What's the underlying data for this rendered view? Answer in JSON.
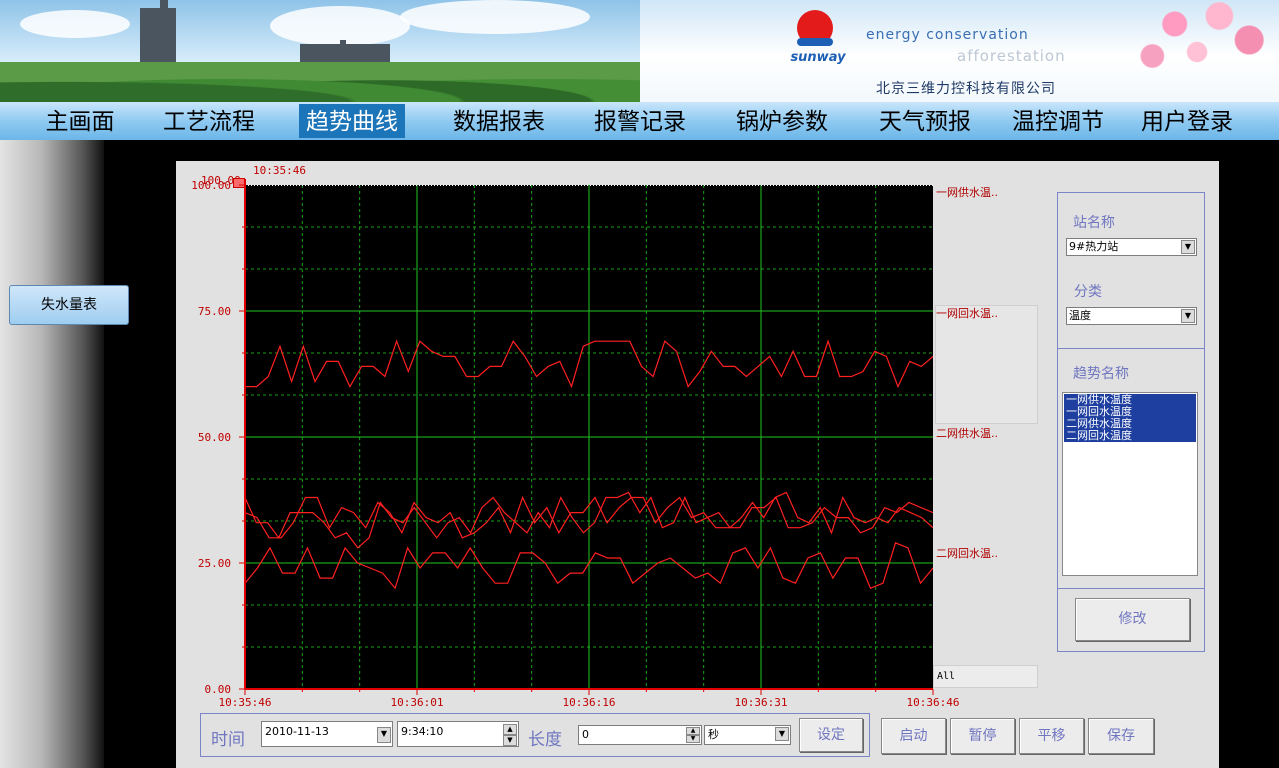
{
  "header": {
    "logo_text": "sunway",
    "slogan_line1": "energy conservation",
    "slogan_line2": "afforestation",
    "company": "北京三维力控科技有限公司"
  },
  "nav": {
    "items": [
      {
        "label": "主画面"
      },
      {
        "label": "工艺流程"
      },
      {
        "label": "趋势曲线",
        "active": true
      },
      {
        "label": "数据报表"
      },
      {
        "label": "报警记录"
      },
      {
        "label": "锅炉参数"
      },
      {
        "label": "天气预报"
      },
      {
        "label": "温控调节"
      },
      {
        "label": "用户登录"
      }
    ]
  },
  "sidebar": {
    "button_label": "失水量表"
  },
  "trend": {
    "top_time": "10:35:46",
    "marker_value": "100.00",
    "legend_all": "All",
    "series_labels": [
      "一网供水温..",
      "一网回水温..",
      "二网供水温..",
      "二网回水温.."
    ]
  },
  "chart_data": {
    "type": "line",
    "x_ticks": [
      "10:35:46",
      "10:36:01",
      "10:36:16",
      "10:36:31",
      "10:36:46"
    ],
    "y_ticks": [
      "100.00",
      "75.00",
      "50.00",
      "25.00",
      "0.00"
    ],
    "ylim": [
      0,
      100
    ],
    "xlim_seconds": [
      0,
      60
    ],
    "grid": true,
    "line_color": "#ff2020",
    "series": [
      {
        "name": "一网供水温..",
        "values": [
          60,
          60,
          62,
          68,
          61,
          68,
          61,
          65,
          65,
          60,
          64,
          64,
          62,
          69,
          63,
          69,
          67,
          66,
          66,
          62,
          62,
          64,
          64,
          69,
          66,
          62,
          64,
          65,
          60,
          68,
          69,
          69,
          69,
          69,
          64,
          62,
          69,
          67,
          60,
          63,
          67,
          64,
          64,
          62,
          64,
          66,
          62,
          67,
          62,
          62,
          69,
          62,
          62,
          63,
          67,
          66,
          60,
          65,
          64,
          66
        ],
        "samples": 60
      },
      {
        "name": "一网回水温..",
        "values": [
          35,
          34,
          30,
          30,
          33,
          38,
          38,
          32,
          36,
          35,
          32,
          37,
          35,
          31,
          37,
          34,
          33,
          35,
          30,
          31,
          33,
          36,
          31,
          38,
          33,
          36,
          31,
          35,
          35,
          38,
          33,
          36,
          38,
          38,
          33,
          36,
          38,
          34,
          35,
          32,
          32,
          32,
          36,
          36,
          38,
          32,
          32,
          33,
          36,
          34,
          34,
          31,
          32,
          36,
          35,
          37,
          36,
          35
        ],
        "samples": 58
      },
      {
        "name": "二网供水温..",
        "values": [
          38,
          33,
          33,
          30,
          35,
          35,
          35,
          33,
          30,
          31,
          28,
          30,
          37,
          34,
          33,
          36,
          33,
          30,
          33,
          34,
          31,
          36,
          38,
          35,
          33,
          31,
          35,
          32,
          38,
          34,
          31,
          33,
          38,
          38,
          39,
          35,
          38,
          32,
          33,
          38,
          33,
          34,
          35,
          32,
          34,
          37,
          34,
          38,
          39,
          34,
          33,
          36,
          31,
          38,
          34,
          33,
          34,
          33,
          36,
          35,
          34,
          32
        ],
        "samples": 62
      },
      {
        "name": "二网回水温..",
        "values": [
          21,
          24,
          28,
          23,
          23,
          28,
          22,
          22,
          28,
          25,
          24,
          23,
          20,
          28,
          24,
          27,
          27,
          24,
          28,
          24,
          21,
          21,
          27,
          27,
          25,
          21,
          23,
          23,
          27,
          26,
          26,
          21,
          23,
          25,
          26,
          24,
          22,
          23,
          21,
          27,
          28,
          24,
          28,
          22,
          21,
          26,
          27,
          22,
          26,
          26,
          20,
          21,
          29,
          28,
          21,
          24
        ],
        "samples": 56
      }
    ]
  },
  "right_panel": {
    "station_label": "站名称",
    "station_value": "9#热力站",
    "category_label": "分类",
    "category_value": "温度",
    "trend_name_label": "趋势名称",
    "trend_names": [
      "一网供水温度",
      "一网回水温度",
      "二网供水温度",
      "二网回水温度"
    ],
    "modify_button": "修改"
  },
  "bottom": {
    "time_label": "时间",
    "date_value": "2010-11-13",
    "time_value": "9:34:10",
    "length_label": "长度",
    "length_value": "0",
    "unit_value": "秒",
    "set_button": "设定",
    "start_button": "启动",
    "pause_button": "暂停",
    "pan_button": "平移",
    "save_button": "保存"
  }
}
